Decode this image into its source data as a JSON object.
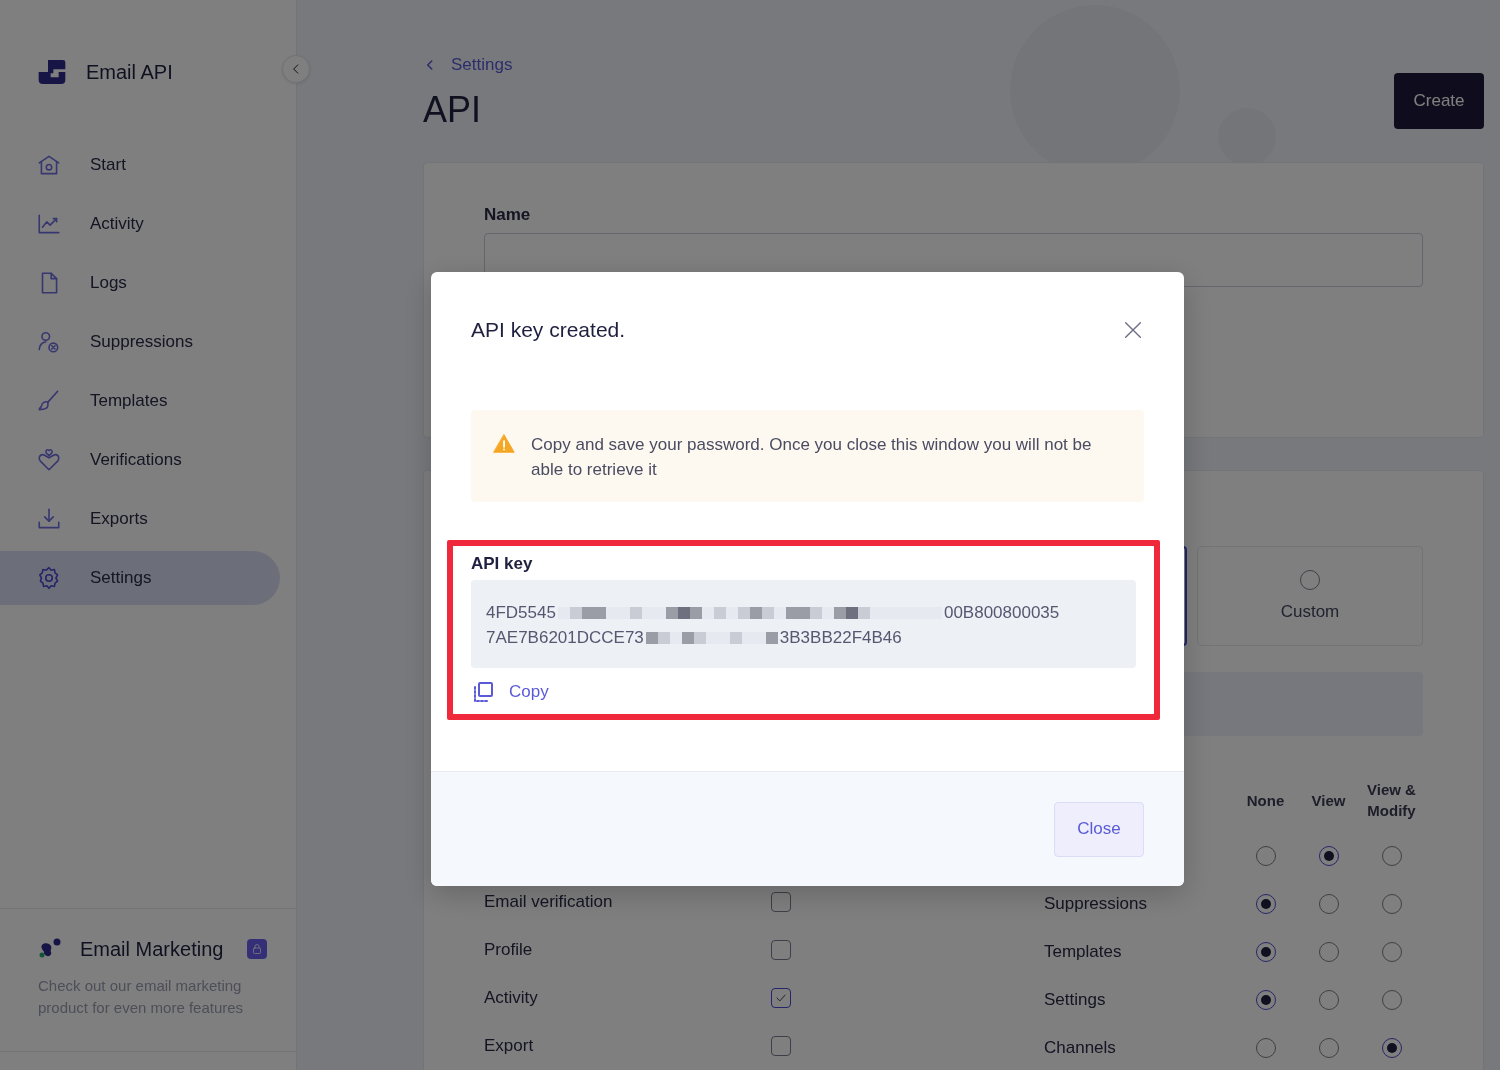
{
  "sidebar": {
    "brand": "Email API",
    "items": [
      {
        "label": "Start",
        "kind": "home",
        "selected": false
      },
      {
        "label": "Activity",
        "kind": "chart",
        "selected": false
      },
      {
        "label": "Logs",
        "kind": "file",
        "selected": false
      },
      {
        "label": "Suppressions",
        "kind": "user-block",
        "selected": false
      },
      {
        "label": "Templates",
        "kind": "brush",
        "selected": false
      },
      {
        "label": "Verifications",
        "kind": "heart",
        "selected": false
      },
      {
        "label": "Exports",
        "kind": "download",
        "selected": false
      },
      {
        "label": "Settings",
        "kind": "gear",
        "selected": true
      }
    ],
    "promo": {
      "title": "Email Marketing",
      "locked": true,
      "text": "Check out our email marketing product for even more features"
    }
  },
  "header": {
    "breadcrumb": "Settings",
    "title": "API",
    "create_button": "Create"
  },
  "form": {
    "name_label": "Name",
    "options": [
      {
        "selected": true
      },
      {
        "label": "Custom",
        "selected": false
      }
    ],
    "columns": [
      "None",
      "View",
      "View & Modify"
    ],
    "left_rows": [
      {
        "label": "Email verification",
        "checked": false
      },
      {
        "label": "Profile",
        "checked": false
      },
      {
        "label": "Activity",
        "checked": true
      },
      {
        "label": "Export",
        "checked": false
      }
    ],
    "right_rows": [
      {
        "radios": [
          {
            "selected": false
          },
          {
            "selected": true
          },
          {
            "selected": false
          }
        ]
      },
      {
        "label": "Suppressions",
        "radios": [
          {
            "selected": true
          },
          {
            "selected": false
          },
          {
            "selected": false
          }
        ]
      },
      {
        "label": "Templates",
        "radios": [
          {
            "selected": true
          },
          {
            "selected": false
          },
          {
            "selected": false
          }
        ]
      },
      {
        "label": "Settings",
        "radios": [
          {
            "selected": true
          },
          {
            "selected": false
          },
          {
            "selected": false
          }
        ]
      },
      {
        "label": "Channels",
        "radios": [
          {
            "selected": false
          },
          {
            "selected": false
          },
          {
            "selected": true
          }
        ]
      }
    ]
  },
  "modal": {
    "title": "API key created.",
    "warning": "Copy and save your password. Once you close this window you will not be able to retrieve it",
    "highlighted": true,
    "key_label": "API key",
    "key_lines": [
      [
        "4FD5545",
        "00B800800035"
      ],
      [
        "7AE7B6201DCCE73",
        "3B3BB22F4B46"
      ]
    ],
    "copy": "Copy",
    "close_button": "Close"
  }
}
